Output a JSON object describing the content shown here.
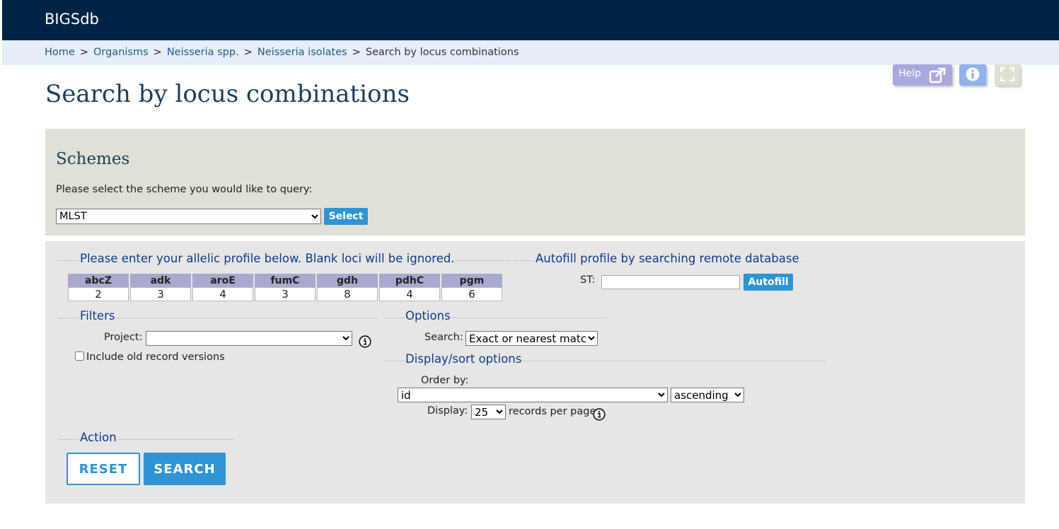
{
  "app": {
    "brand": "BIGSdb"
  },
  "breadcrumb": {
    "items": [
      "Home",
      "Organisms",
      "Neisseria spp.",
      "Neisseria isolates"
    ],
    "separator": ">",
    "current": "Search by locus combinations"
  },
  "toolbar": {
    "help_label": "Help",
    "help_icon": "external-link-icon",
    "info_icon": "info-icon",
    "expand_icon": "expand-icon",
    "help_color": "#a9a9e0",
    "info_color": "#8fb2ea"
  },
  "page_title": "Search by locus combinations",
  "schemes": {
    "heading": "Schemes",
    "prompt": "Please select the scheme you would like to query:",
    "selected": "MLST",
    "select_button": "Select"
  },
  "profile": {
    "legend": "Please enter your allelic profile below. Blank loci will be ignored.",
    "loci": [
      "abcZ",
      "adk",
      "aroE",
      "fumC",
      "gdh",
      "pdhC",
      "pgm"
    ],
    "values": [
      "2",
      "3",
      "4",
      "3",
      "8",
      "4",
      "6"
    ]
  },
  "autofill": {
    "legend": "Autofill profile by searching remote database",
    "st_label": "ST:",
    "st_value": "",
    "button": "Autofill"
  },
  "filters": {
    "legend": "Filters",
    "project_label": "Project:",
    "project_value": "",
    "old_versions_label": "Include old record versions",
    "old_versions_checked": false
  },
  "options": {
    "legend": "Options",
    "search_label": "Search:",
    "search_value": "Exact or nearest match"
  },
  "display_sort": {
    "legend": "Display/sort options",
    "order_by_label": "Order by:",
    "order_by_value": "id",
    "direction_value": "ascending",
    "display_label": "Display:",
    "display_value": "25",
    "records_suffix": "records per page"
  },
  "action": {
    "legend": "Action",
    "reset": "RESET",
    "search": "SEARCH"
  },
  "colors": {
    "header_bg": "#012444",
    "crumb_bg": "#e6eef9",
    "accent": "#2e94d4",
    "legend_text": "#0d3a8a",
    "locus_header_bg": "#a9a9cf"
  }
}
